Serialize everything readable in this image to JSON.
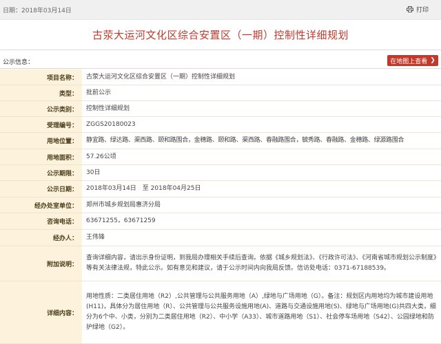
{
  "header": {
    "date": "日期：2018年03月14日",
    "print_label": "打印"
  },
  "title": "古荥大运河文化区综合安置区（一期）控制性详细规划",
  "section": {
    "label": "公示信息：",
    "map_button": "在地图上查看"
  },
  "rows": [
    {
      "key": "项目名称：",
      "value": "古荥大运河文化区综合安置区（一期）控制性详细规划"
    },
    {
      "key": "类型：",
      "value": "批前公示"
    },
    {
      "key": "公示类别：",
      "value": "控制性详细规划"
    },
    {
      "key": "受理编号：",
      "value": "ZGGS20180023"
    },
    {
      "key": "用地位置：",
      "value": "静宜路、绿达路、渠西路、颐和路围合，金穗路、颐和路、渠西路、春融路围合，毓秀路、春融路、金穗路、绿源路围合"
    },
    {
      "key": "用地面积：",
      "value": "57.26公顷"
    },
    {
      "key": "公示期限：",
      "value": "30日"
    },
    {
      "key": "公示日期：",
      "value": "2018年03月14日　至 2018年04月25日"
    },
    {
      "key": "经办处室单位：",
      "value": "郑州市城乡规划局惠济分局"
    },
    {
      "key": "咨询电话：",
      "value": "63671255，63671259"
    },
    {
      "key": "经办人：",
      "value": "王伟锋"
    },
    {
      "key": "附加说明：",
      "value": "查询详细内容，请出示身份证明，到我局办理相关手续后查询。依据《城乡规划法》、《行政许可法》、《河南省城市规划公示制度》等有关法律法规，特此公示。如有意见和建议，请于公示时间内向我局反馈。信访处电话：0371-67188539。"
    },
    {
      "key": "详细内容：",
      "value": "用地性质：二类居住用地（R2）,公共管理与公共服务用地（A）,绿地与广场用地（G）。备注：规划区内用地均为城市建设用地(H11)，具体分为居住用地（R）、公共管理与公共服务设施用地(A)、道路与交通设施用地(S)、绿地与广场用地(G)共四大类，细分为6个中、小类，分别为二类居住用地（R2）、中小学（A33）、城市道路用地（S1）、社会停车场用地（S42）、公园绿地和防护绿地（G2）。"
    }
  ],
  "colors": {
    "accent": "#c0392b",
    "label_bg": "#fdf3dc"
  }
}
